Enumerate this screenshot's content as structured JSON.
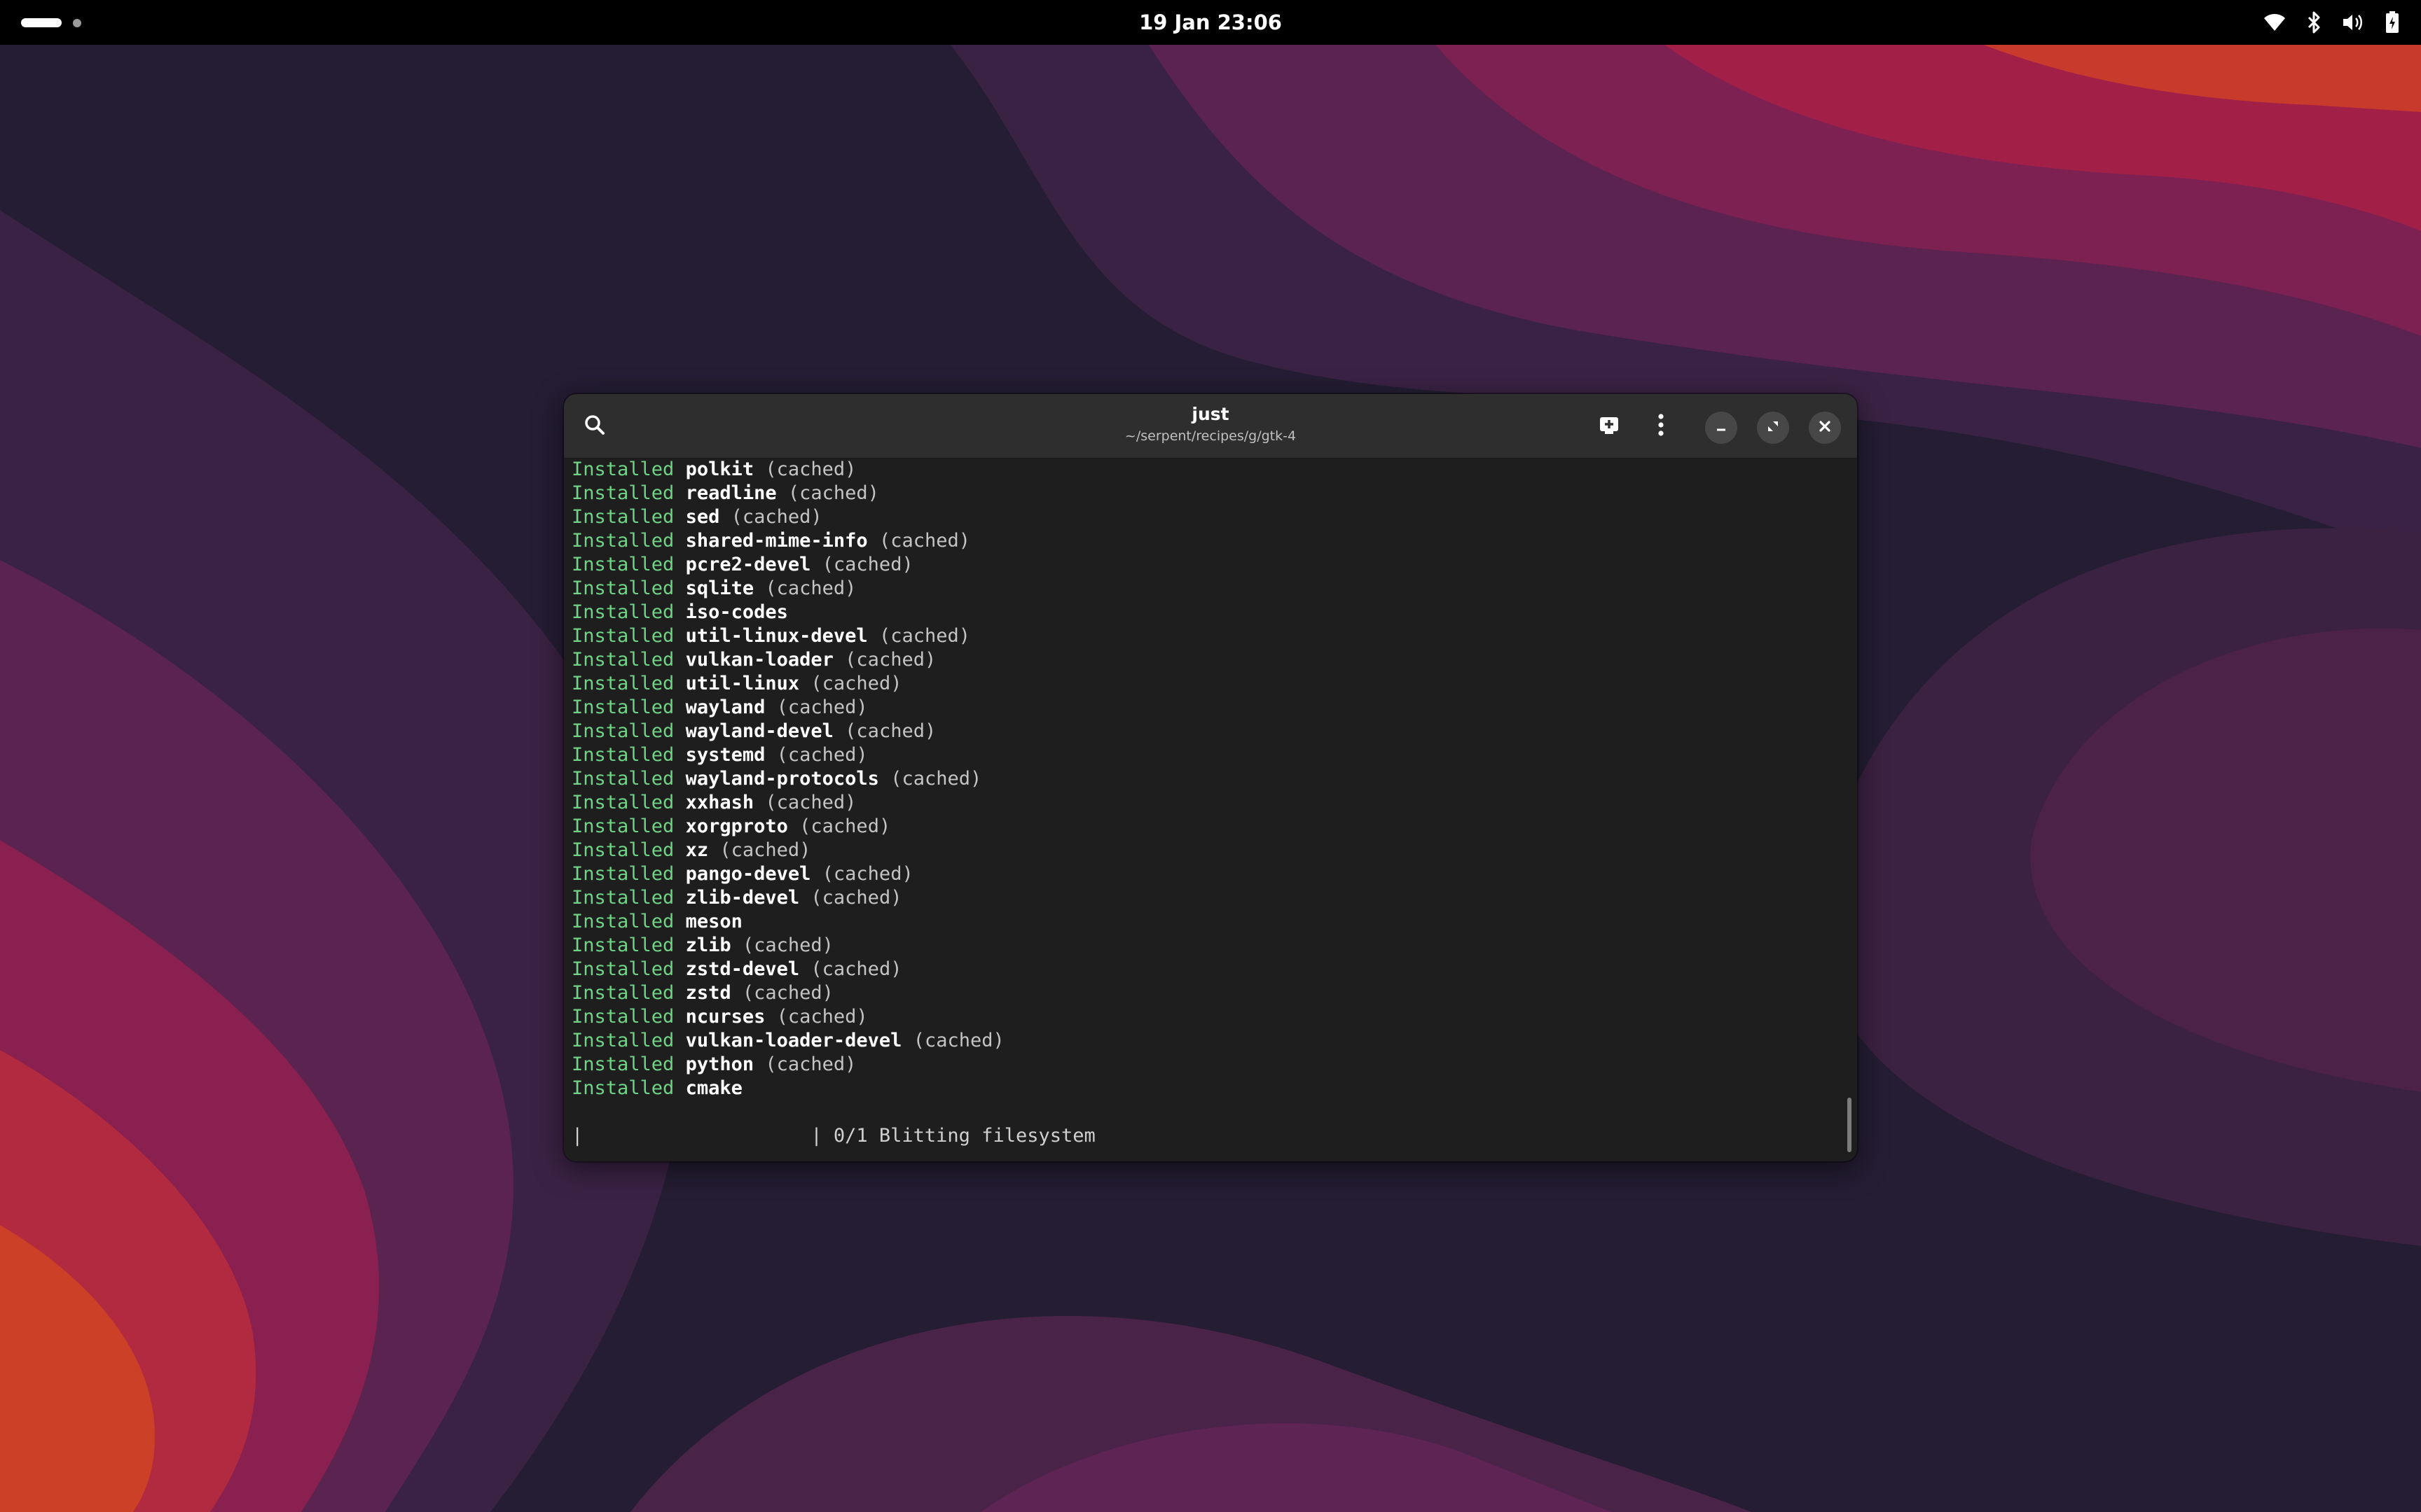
{
  "topbar": {
    "clock": "19 Jan  23:06",
    "icons": [
      "wifi-icon",
      "bluetooth-icon",
      "volume-icon",
      "battery-icon"
    ]
  },
  "window": {
    "title": "just",
    "subtitle": "~/serpent/recipes/g/gtk-4",
    "buttons": [
      "search-icon",
      "new-tab-icon",
      "menu-icon",
      "minimize-icon",
      "maximize-icon",
      "close-icon"
    ]
  },
  "terminal": {
    "keyword": "Installed",
    "lines": [
      {
        "pkg": "polkit",
        "note": "(cached)"
      },
      {
        "pkg": "readline",
        "note": "(cached)"
      },
      {
        "pkg": "sed",
        "note": "(cached)"
      },
      {
        "pkg": "shared-mime-info",
        "note": "(cached)"
      },
      {
        "pkg": "pcre2-devel",
        "note": "(cached)"
      },
      {
        "pkg": "sqlite",
        "note": "(cached)"
      },
      {
        "pkg": "iso-codes",
        "note": ""
      },
      {
        "pkg": "util-linux-devel",
        "note": "(cached)"
      },
      {
        "pkg": "vulkan-loader",
        "note": "(cached)"
      },
      {
        "pkg": "util-linux",
        "note": "(cached)"
      },
      {
        "pkg": "wayland",
        "note": "(cached)"
      },
      {
        "pkg": "wayland-devel",
        "note": "(cached)"
      },
      {
        "pkg": "systemd",
        "note": "(cached)"
      },
      {
        "pkg": "wayland-protocols",
        "note": "(cached)"
      },
      {
        "pkg": "xxhash",
        "note": "(cached)"
      },
      {
        "pkg": "xorgproto",
        "note": "(cached)"
      },
      {
        "pkg": "xz",
        "note": "(cached)"
      },
      {
        "pkg": "pango-devel",
        "note": "(cached)"
      },
      {
        "pkg": "zlib-devel",
        "note": "(cached)"
      },
      {
        "pkg": "meson",
        "note": ""
      },
      {
        "pkg": "zlib",
        "note": "(cached)"
      },
      {
        "pkg": "zstd-devel",
        "note": "(cached)"
      },
      {
        "pkg": "zstd",
        "note": "(cached)"
      },
      {
        "pkg": "ncurses",
        "note": "(cached)"
      },
      {
        "pkg": "vulkan-loader-devel",
        "note": "(cached)"
      },
      {
        "pkg": "python",
        "note": "(cached)"
      },
      {
        "pkg": "cmake",
        "note": ""
      }
    ],
    "progress": "|                    | 0/1 Blitting filesystem"
  },
  "colors": {
    "keyword": "#6fd486",
    "terminal_bg": "#1e1e1e",
    "headerbar_bg": "#2e2e2e"
  }
}
